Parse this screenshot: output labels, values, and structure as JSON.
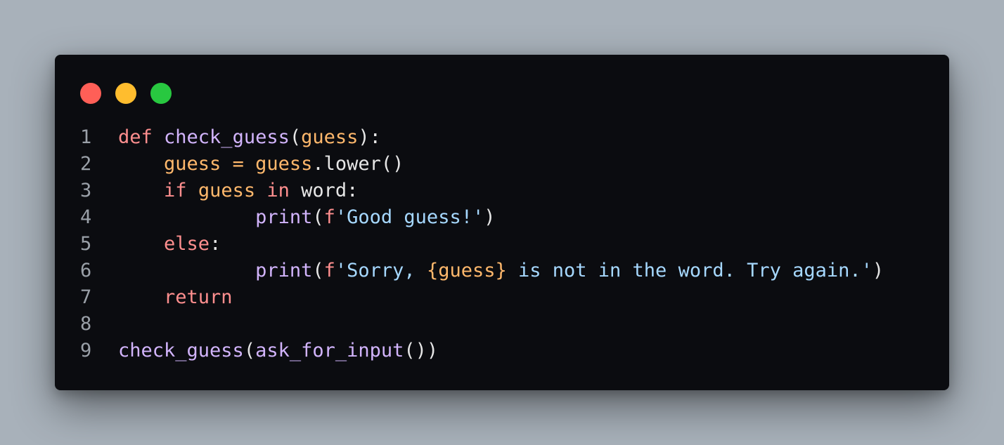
{
  "window_buttons": [
    {
      "name": "close",
      "color": "#ff5f57"
    },
    {
      "name": "minimize",
      "color": "#ffbd2e"
    },
    {
      "name": "maximize",
      "color": "#28c840"
    }
  ],
  "colors": {
    "keyword": "#ff8f8f",
    "function": "#d2b4fc",
    "variable": "#ffb86c",
    "string": "#a6d8ff",
    "plain": "#e6e6e6",
    "line_number": "#9aa0a8"
  },
  "code_lines": [
    {
      "number": "1",
      "tokens": [
        {
          "text": "def ",
          "type": "keyword"
        },
        {
          "text": "check_guess",
          "type": "function"
        },
        {
          "text": "(",
          "type": "plain"
        },
        {
          "text": "guess",
          "type": "variable"
        },
        {
          "text": "):",
          "type": "plain"
        }
      ]
    },
    {
      "number": "2",
      "tokens": [
        {
          "text": "    ",
          "type": "plain"
        },
        {
          "text": "guess",
          "type": "variable"
        },
        {
          "text": " = ",
          "type": "variable"
        },
        {
          "text": "guess",
          "type": "variable"
        },
        {
          "text": ".lower()",
          "type": "plain"
        }
      ]
    },
    {
      "number": "3",
      "tokens": [
        {
          "text": "    ",
          "type": "plain"
        },
        {
          "text": "if ",
          "type": "keyword"
        },
        {
          "text": "guess ",
          "type": "variable"
        },
        {
          "text": "in ",
          "type": "keyword"
        },
        {
          "text": "word:",
          "type": "plain"
        }
      ]
    },
    {
      "number": "4",
      "tokens": [
        {
          "text": "            ",
          "type": "plain"
        },
        {
          "text": "print",
          "type": "function"
        },
        {
          "text": "(",
          "type": "plain"
        },
        {
          "text": "f",
          "type": "keyword"
        },
        {
          "text": "'Good guess!'",
          "type": "string"
        },
        {
          "text": ")",
          "type": "plain"
        }
      ]
    },
    {
      "number": "5",
      "tokens": [
        {
          "text": "    ",
          "type": "plain"
        },
        {
          "text": "else",
          "type": "keyword"
        },
        {
          "text": ":",
          "type": "plain"
        }
      ]
    },
    {
      "number": "6",
      "tokens": [
        {
          "text": "            ",
          "type": "plain"
        },
        {
          "text": "print",
          "type": "function"
        },
        {
          "text": "(",
          "type": "plain"
        },
        {
          "text": "f",
          "type": "keyword"
        },
        {
          "text": "'Sorry, ",
          "type": "string"
        },
        {
          "text": "{guess}",
          "type": "variable"
        },
        {
          "text": " is not in the word. Try again.'",
          "type": "string"
        },
        {
          "text": ")",
          "type": "plain"
        }
      ]
    },
    {
      "number": "7",
      "tokens": [
        {
          "text": "    ",
          "type": "plain"
        },
        {
          "text": "return",
          "type": "keyword"
        }
      ]
    },
    {
      "number": "8",
      "tokens": []
    },
    {
      "number": "9",
      "tokens": [
        {
          "text": "check_guess",
          "type": "function"
        },
        {
          "text": "(",
          "type": "plain"
        },
        {
          "text": "ask_for_input",
          "type": "function"
        },
        {
          "text": "())",
          "type": "plain"
        }
      ]
    }
  ]
}
